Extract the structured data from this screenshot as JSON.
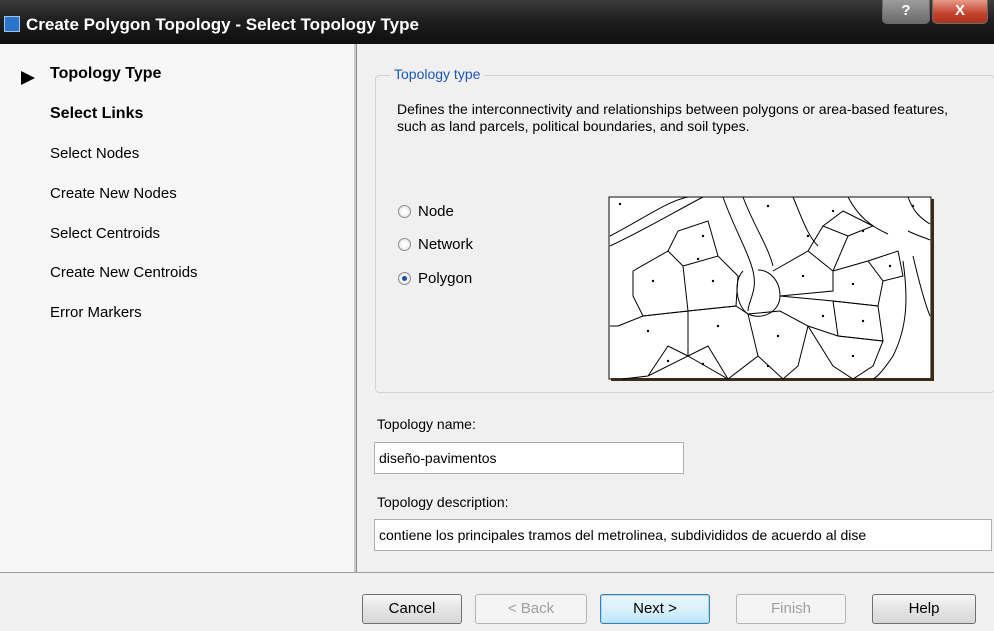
{
  "window": {
    "title": "Create Polygon Topology - Select Topology Type",
    "help_label": "?",
    "close_label": "X"
  },
  "nav": {
    "items": [
      {
        "label": "Topology Type",
        "current": true
      },
      {
        "label": "Select Links"
      },
      {
        "label": "Select Nodes"
      },
      {
        "label": "Create New Nodes"
      },
      {
        "label": "Select Centroids"
      },
      {
        "label": "Create New Centroids"
      },
      {
        "label": "Error Markers"
      }
    ]
  },
  "topology_type": {
    "group_label": "Topology type",
    "description": "Defines the interconnectivity and relationships between polygons or area-based features, such as land parcels, political boundaries, and soil types.",
    "options": [
      {
        "label": "Node",
        "checked": false
      },
      {
        "label": "Network",
        "checked": false
      },
      {
        "label": "Polygon",
        "checked": true
      }
    ]
  },
  "topology_name": {
    "label": "Topology name:",
    "value": "diseño-pavimentos"
  },
  "topology_description": {
    "label": "Topology description:",
    "value": "contiene los principales tramos del metrolinea, subdivididos de acuerdo al dise"
  },
  "buttons": {
    "cancel": "Cancel",
    "back": "< Back",
    "next": "Next >",
    "finish": "Finish",
    "help": "Help"
  }
}
